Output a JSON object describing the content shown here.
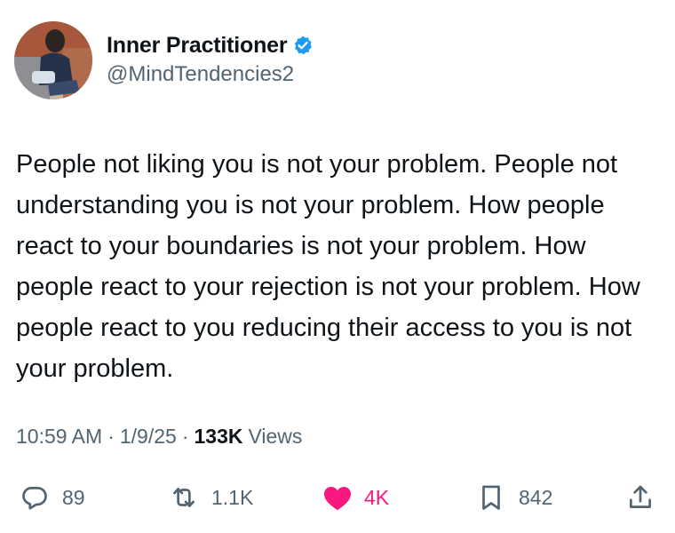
{
  "author": {
    "display_name": "Inner Practitioner",
    "handle": "@MindTendencies2",
    "verified": true,
    "verified_color": "#1d9bf0",
    "avatar_icon": "profile-photo"
  },
  "tweet": {
    "text": "People not liking you is not your problem. People not understanding you is not your problem. How people react to your boundaries is not your problem. How people react to your rejection is not your problem. How people react to you reducing their access to you is not your problem."
  },
  "meta": {
    "time": "10:59 AM",
    "date": "1/9/25",
    "views_count": "133K",
    "views_label": "Views"
  },
  "actions": {
    "replies": "89",
    "reposts": "1.1K",
    "likes": "4K",
    "bookmarks": "842",
    "liked": true,
    "like_color": "#f91880",
    "icons": {
      "reply": "speech-bubble-icon",
      "repost": "repost-arrows-icon",
      "like": "heart-icon",
      "bookmark": "bookmark-icon",
      "share": "share-upload-icon"
    }
  }
}
